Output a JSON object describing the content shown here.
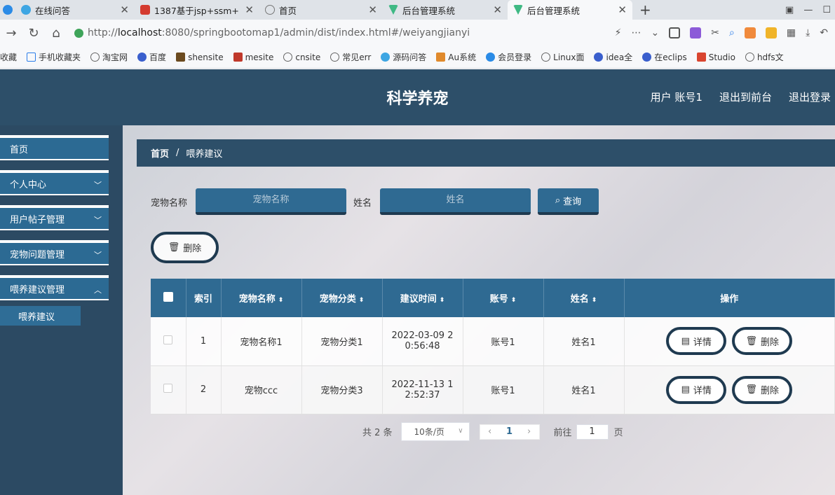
{
  "browser": {
    "tabs": [
      {
        "label": "",
        "color": "#2b8be6"
      },
      {
        "label": "在线问答",
        "color": "#3ea6e3"
      },
      {
        "label": "1387基于jsp+ssm+",
        "color": "#d43b30"
      },
      {
        "label": "首页",
        "color": "#888888"
      },
      {
        "label": "后台管理系统",
        "color": "#3fb984"
      },
      {
        "label": "后台管理系统",
        "color": "#3fb984"
      }
    ],
    "url_prefix": "http://",
    "url_host": "localhost",
    "url_rest": ":8080/springbootomap1/admin/dist/index.html#/weiyangjianyi",
    "bookmarks": [
      "收藏",
      "手机收藏夹",
      "淘宝网",
      "百度",
      "shensite",
      "mesite",
      "cnsite",
      "常见err",
      "源码问答",
      "Au系统",
      "会员登录",
      "Linux面",
      "idea全",
      "在eclips",
      "Studio",
      "hdfs文"
    ]
  },
  "header": {
    "title": "科学养宠",
    "user": "用户 账号1",
    "front": "退出到前台",
    "logout": "退出登录"
  },
  "sidebar": {
    "items": [
      {
        "label": "首页"
      },
      {
        "label": "个人中心"
      },
      {
        "label": "用户帖子管理"
      },
      {
        "label": "宠物问题管理"
      },
      {
        "label": "喂养建议管理"
      }
    ],
    "sub_item": "喂养建议"
  },
  "breadcrumb": {
    "home": "首页",
    "sep": "/",
    "current": "喂养建议"
  },
  "search": {
    "pet_label": "宠物名称",
    "pet_placeholder": "宠物名称",
    "name_label": "姓名",
    "name_placeholder": "姓名",
    "query_label": "查询"
  },
  "delete_label": "删除",
  "table": {
    "headers": [
      "索引",
      "宠物名称",
      "宠物分类",
      "建议时间",
      "账号",
      "姓名",
      "操作"
    ],
    "rows": [
      {
        "index": "1",
        "pet": "宠物名称1",
        "category": "宠物分类1",
        "time_a": "2022-03-09 2",
        "time_b": "0:56:48",
        "account": "账号1",
        "name": "姓名1",
        "detail": "详情",
        "delete": "删除"
      },
      {
        "index": "2",
        "pet": "宠物ccc",
        "category": "宠物分类3",
        "time_a": "2022-11-13 1",
        "time_b": "2:52:37",
        "account": "账号1",
        "name": "姓名1",
        "detail": "详情",
        "delete": "删除"
      }
    ]
  },
  "pager": {
    "total": "共 2 条",
    "page_size": "10条/页",
    "current": "1",
    "goto_label": "前往",
    "goto_value": "1",
    "page_suffix": "页"
  },
  "colors": {
    "header": "#2d4f69",
    "accent": "#2f6a92",
    "sidebar": "#2c4a63"
  }
}
